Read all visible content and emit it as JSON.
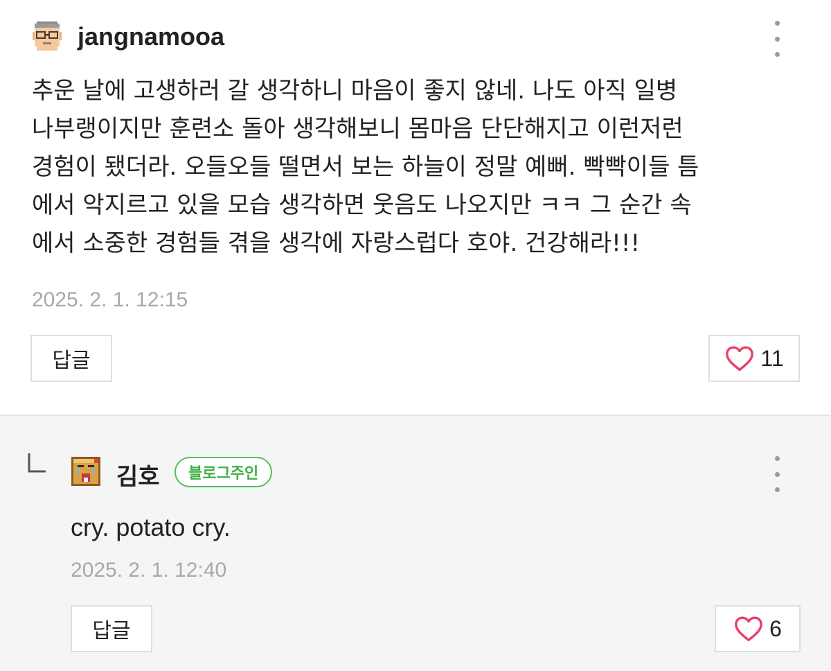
{
  "comments": [
    {
      "author": "jangnamooa",
      "lines": [
        "추운 날에 고생하러 갈 생각하니 마음이 좋지 않네. 나도 아직 일병",
        "나부랭이지만 훈련소 돌아 생각해보니 몸마음 단단해지고 이런저런",
        "경험이 됐더라. 오들오들 떨면서 보는 하늘이 정말 예뻐. 빡빡이들 틈",
        "에서 악지르고 있을 모습 생각하면 웃음도 나오지만 ㅋㅋ 그 순간 속",
        "에서 소중한 경험들 겪을 생각에 자랑스럽다 호야. 건강해라!!!"
      ],
      "date": "2025. 2. 1. 12:15",
      "reply_label": "답글",
      "likes": "11",
      "avatar_icon": "glasses-face-icon"
    }
  ],
  "reply": {
    "author": "김호",
    "badge": "블로그주인",
    "text": "cry. potato cry.",
    "date": "2025. 2. 1. 12:40",
    "reply_label": "답글",
    "likes": "6",
    "avatar_icon": "crying-block-icon"
  },
  "colors": {
    "badge_green": "#52c15a",
    "heart_pink": "#e8406c",
    "reply_bg": "#f5f5f5",
    "date_gray": "#a8a8a8"
  }
}
